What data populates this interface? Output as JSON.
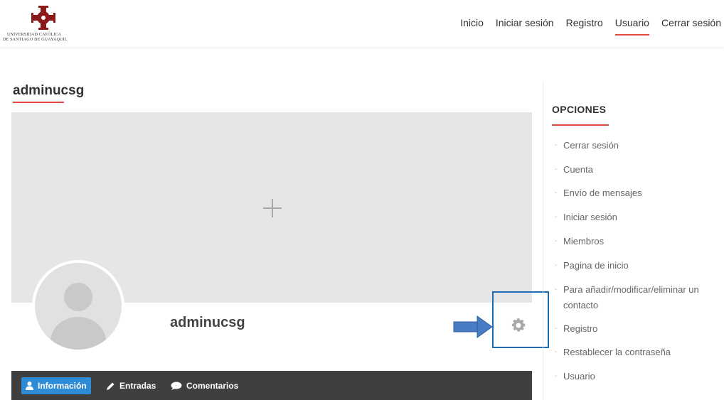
{
  "logo": {
    "line1": "UNIVERSIDAD CATÓLICA",
    "line2": "DE SANTIAGO DE GUAYAQUIL",
    "brand_color": "#8b1a1a"
  },
  "nav": {
    "items": [
      {
        "label": "Inicio",
        "active": false
      },
      {
        "label": "Iniciar sesión",
        "active": false
      },
      {
        "label": "Registro",
        "active": false
      },
      {
        "label": "Usuario",
        "active": true
      },
      {
        "label": "Cerrar sesión",
        "active": false
      }
    ]
  },
  "profile": {
    "title": "adminucsg",
    "name": "adminucsg"
  },
  "tabs": [
    {
      "label": "Información",
      "icon": "user-icon",
      "active": true
    },
    {
      "label": "Entradas",
      "icon": "pencil-icon",
      "active": false
    },
    {
      "label": "Comentarios",
      "icon": "comment-icon",
      "active": false
    }
  ],
  "sidebar": {
    "title": "OPCIONES",
    "items": [
      {
        "label": "Cerrar sesión"
      },
      {
        "label": "Cuenta"
      },
      {
        "label": "Envío de mensajes"
      },
      {
        "label": "Iniciar sesión"
      },
      {
        "label": "Miembros"
      },
      {
        "label": "Pagina de inicio"
      },
      {
        "label": "Para añadir/modificar/eliminar un contacto"
      },
      {
        "label": "Registro"
      },
      {
        "label": "Restablecer la contraseña"
      },
      {
        "label": "Usuario"
      }
    ]
  },
  "colors": {
    "accent": "#e34a40",
    "tab_active": "#2e8bd6",
    "tabbar": "#3f3f3f",
    "highlight": "#1f6cb4"
  }
}
